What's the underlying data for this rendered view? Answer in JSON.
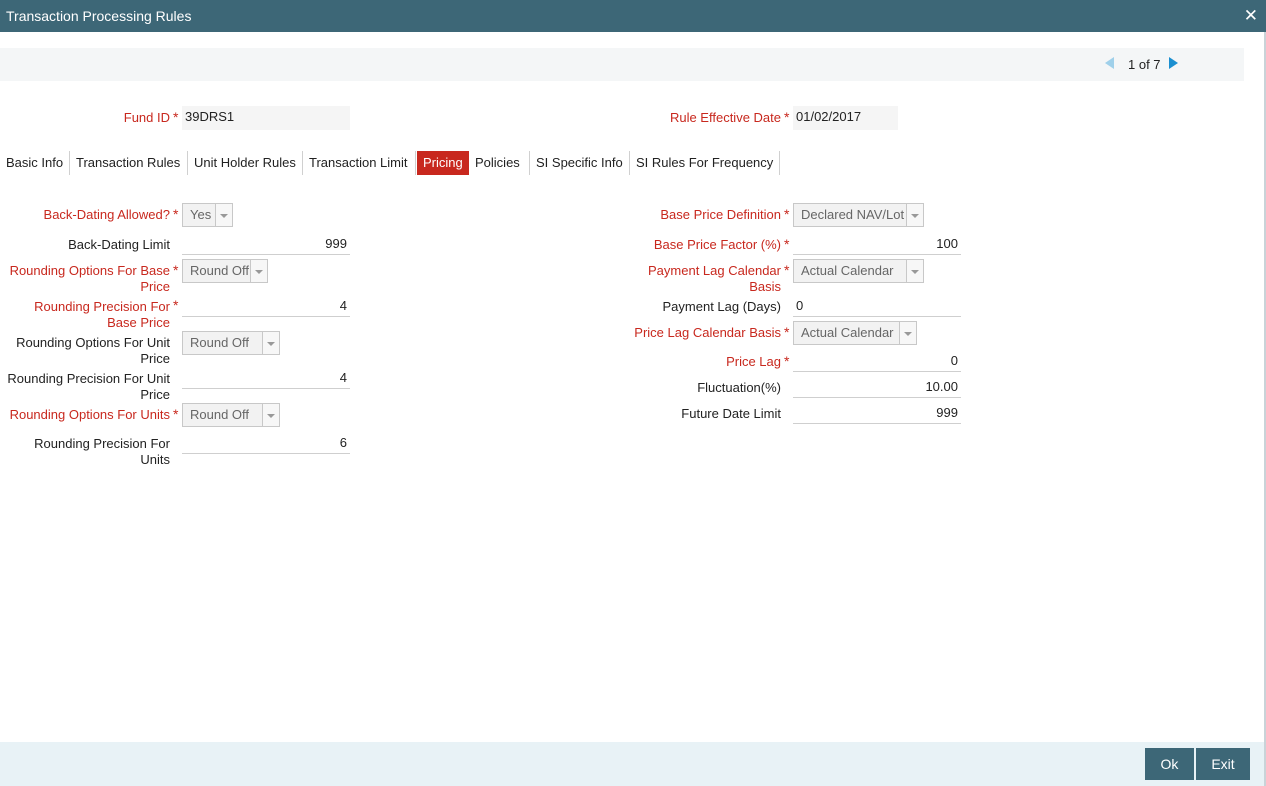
{
  "window": {
    "title": "Transaction Processing Rules",
    "close_icon": "close-icon"
  },
  "pager": {
    "text": "1 of 7"
  },
  "header": {
    "fund_id": {
      "label": "Fund ID",
      "value": "39DRS1"
    },
    "rule_effective_date": {
      "label": "Rule Effective Date",
      "value": "01/02/2017"
    }
  },
  "tabs": [
    "Basic Info",
    "Transaction Rules",
    "Unit Holder Rules",
    "Transaction Limit",
    "Pricing",
    "Policies",
    "SI Specific Info",
    "SI Rules For Frequency"
  ],
  "active_tab": "Pricing",
  "left": {
    "back_dating_allowed": {
      "label": "Back-Dating Allowed?",
      "value": "Yes"
    },
    "back_dating_limit": {
      "label": "Back-Dating Limit",
      "value": "999"
    },
    "rounding_options_base_price": {
      "label1": "Rounding Options For Base",
      "label2": "Price",
      "value": "Round Off"
    },
    "rounding_precision_base_price": {
      "label1": "Rounding Precision For",
      "label2": "Base Price",
      "value": "4"
    },
    "rounding_options_unit_price": {
      "label1": "Rounding Options For Unit",
      "label2": "Price",
      "value": "Round Off"
    },
    "rounding_precision_unit_price": {
      "label1": "Rounding Precision For Unit",
      "label2": "Price",
      "value": "4"
    },
    "rounding_options_units": {
      "label": "Rounding Options For Units",
      "value": "Round Off"
    },
    "rounding_precision_units": {
      "label1": "Rounding Precision For",
      "label2": "Units",
      "value": "6"
    }
  },
  "right": {
    "base_price_definition": {
      "label": "Base Price Definition",
      "value": "Declared NAV/Lot"
    },
    "base_price_factor": {
      "label": "Base Price Factor (%)",
      "value": "100"
    },
    "payment_lag_calendar_basis": {
      "label1": "Payment Lag Calendar",
      "label2": "Basis",
      "value": "Actual Calendar"
    },
    "payment_lag_days": {
      "label": "Payment Lag (Days)",
      "value": "0"
    },
    "price_lag_calendar_basis": {
      "label": "Price Lag Calendar Basis",
      "value": "Actual Calendar"
    },
    "price_lag": {
      "label": "Price Lag",
      "value": "0"
    },
    "fluctuation": {
      "label": "Fluctuation(%)",
      "value": "10.00"
    },
    "future_date_limit": {
      "label": "Future Date Limit",
      "value": "999"
    }
  },
  "footer": {
    "ok_label": "Ok",
    "exit_label": "Exit"
  },
  "colors": {
    "title_bar": "#3d6777",
    "required": "#c8281e",
    "active_tab": "#c8281e",
    "pager_next": "#1b8fd0"
  }
}
